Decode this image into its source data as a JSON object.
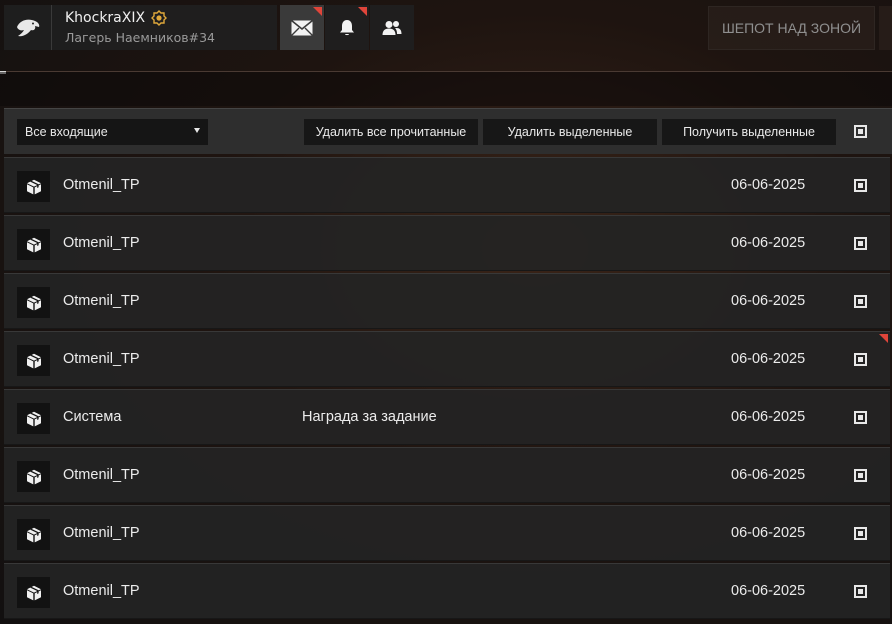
{
  "header": {
    "username": "KhockraXIX",
    "clan": "Лагерь Наемников#34",
    "whisper_label": "ШЕПОТ НАД ЗОНОЙ",
    "icons": {
      "logo": "eagle-logo-icon",
      "badge": "gold-rank-badge-icon",
      "mail": "envelope-icon",
      "notifications": "bell-icon",
      "friends": "friends-icon"
    },
    "accent_color": "#e0453a"
  },
  "toolbar": {
    "filter_selected": "Все входящие",
    "delete_read_label": "Удалить все прочитанные",
    "delete_selected_label": "Удалить выделенные",
    "receive_selected_label": "Получить выделенные"
  },
  "messages": [
    {
      "sender": "Otmenil_TP",
      "subject": "",
      "date": "06-06-2025",
      "icon": "package-icon"
    },
    {
      "sender": "Otmenil_TP",
      "subject": "",
      "date": "06-06-2025",
      "icon": "package-icon"
    },
    {
      "sender": "Otmenil_TP",
      "subject": "",
      "date": "06-06-2025",
      "icon": "package-icon"
    },
    {
      "sender": "Otmenil_TP",
      "subject": "",
      "date": "06-06-2025",
      "icon": "package-icon",
      "unread": true
    },
    {
      "sender": "Система",
      "subject": "Награда за задание",
      "date": "06-06-2025",
      "icon": "package-icon"
    },
    {
      "sender": "Otmenil_TP",
      "subject": "",
      "date": "06-06-2025",
      "icon": "package-icon"
    },
    {
      "sender": "Otmenil_TP",
      "subject": "",
      "date": "06-06-2025",
      "icon": "package-icon"
    },
    {
      "sender": "Otmenil_TP",
      "subject": "",
      "date": "06-06-2025",
      "icon": "package-icon"
    }
  ]
}
